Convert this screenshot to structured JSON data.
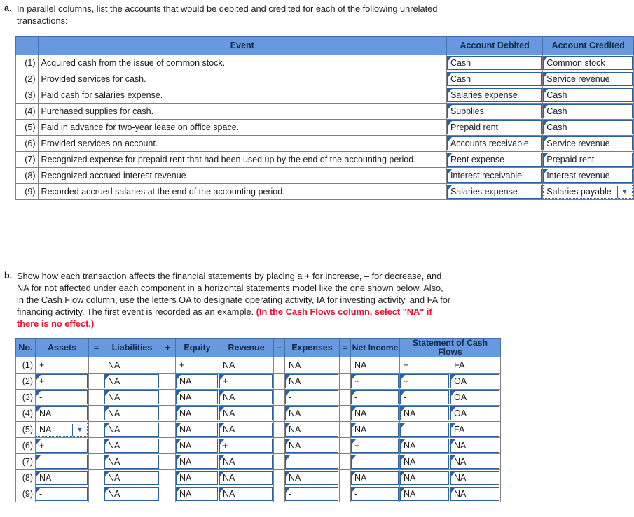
{
  "prompt_a": {
    "letter": "a.",
    "text": "In parallel columns, list the accounts that would be debited and credited for each of the following unrelated transactions:"
  },
  "prompt_b": {
    "letter": "b.",
    "text": "Show how each transaction affects the financial statements by placing a + for increase, – for decrease, and NA for not affected under each component in a horizontal statements model like the one shown below. Also, in the Cash Flow column, use the letters OA to designate operating activity, IA for investing activity, and FA for financing activity. The first event is recorded as an example. ",
    "highlight": "(In the Cash Flows column, select \"NA\" if there is no effect.)"
  },
  "accounts_table": {
    "headers": {
      "num": "",
      "event": "Event",
      "debited": "Account Debited",
      "credited": "Account Credited"
    },
    "rows": [
      {
        "num": "(1)",
        "event": "Acquired cash from the issue of common stock.",
        "debited": "Cash",
        "credited": "Common stock",
        "active": ""
      },
      {
        "num": "(2)",
        "event": "Provided services for cash.",
        "debited": "Cash",
        "credited": "Service revenue",
        "active": ""
      },
      {
        "num": "(3)",
        "event": "Paid cash for salaries expense.",
        "debited": "Salaries expense",
        "credited": "Cash",
        "active": ""
      },
      {
        "num": "(4)",
        "event": "Purchased supplies for cash.",
        "debited": "Supplies",
        "credited": "Cash",
        "active": ""
      },
      {
        "num": "(5)",
        "event": "Paid in advance for two-year lease on office space.",
        "debited": "Prepaid rent",
        "credited": "Cash",
        "active": ""
      },
      {
        "num": "(6)",
        "event": "Provided services on account.",
        "debited": "Accounts receivable",
        "credited": "Service revenue",
        "active": ""
      },
      {
        "num": "(7)",
        "event": "Recognized expense for prepaid rent that had been used up by the end of the accounting period.",
        "debited": "Rent expense",
        "credited": "Prepaid rent",
        "active": ""
      },
      {
        "num": "(8)",
        "event": "Recognized accrued interest revenue",
        "debited": "Interest receivable",
        "credited": "Interest revenue",
        "active": ""
      },
      {
        "num": "(9)",
        "event": "Recorded accrued salaries at the end of the accounting period.",
        "debited": "Salaries expense",
        "credited": "Salaries payable",
        "active": "credited"
      }
    ]
  },
  "model_table": {
    "headers": {
      "no": "No.",
      "assets": "Assets",
      "eq1": "=",
      "liabilities": "Liabilities",
      "plus1": "+",
      "equity": "Equity",
      "revenue": "Revenue",
      "minus": "–",
      "expenses": "Expenses",
      "eq2": "=",
      "net_income": "Net Income",
      "cash_flows": "Statement of Cash Flows"
    },
    "rows": [
      {
        "no": "(1)",
        "assets": "+",
        "liabilities": "NA",
        "equity": "+",
        "revenue": "NA",
        "expenses": "NA",
        "net_income": "NA",
        "cf_sign": "+",
        "cf_type": "FA",
        "example": true,
        "active": ""
      },
      {
        "no": "(2)",
        "assets": "+",
        "liabilities": "NA",
        "equity": "NA",
        "revenue": "+",
        "expenses": "NA",
        "net_income": "+",
        "cf_sign": "+",
        "cf_type": "OA",
        "example": false,
        "active": ""
      },
      {
        "no": "(3)",
        "assets": "-",
        "liabilities": "NA",
        "equity": "NA",
        "revenue": "NA",
        "expenses": "-",
        "net_income": "-",
        "cf_sign": "-",
        "cf_type": "OA",
        "example": false,
        "active": ""
      },
      {
        "no": "(4)",
        "assets": "NA",
        "liabilities": "NA",
        "equity": "NA",
        "revenue": "NA",
        "expenses": "NA",
        "net_income": "NA",
        "cf_sign": "NA",
        "cf_type": "OA",
        "example": false,
        "active": ""
      },
      {
        "no": "(5)",
        "assets": "NA",
        "liabilities": "NA",
        "equity": "NA",
        "revenue": "NA",
        "expenses": "NA",
        "net_income": "NA",
        "cf_sign": "-",
        "cf_type": "FA",
        "example": false,
        "active": "assets"
      },
      {
        "no": "(6)",
        "assets": "+",
        "liabilities": "NA",
        "equity": "NA",
        "revenue": "+",
        "expenses": "NA",
        "net_income": "+",
        "cf_sign": "NA",
        "cf_type": "NA",
        "example": false,
        "active": ""
      },
      {
        "no": "(7)",
        "assets": "-",
        "liabilities": "NA",
        "equity": "NA",
        "revenue": "NA",
        "expenses": "-",
        "net_income": "-",
        "cf_sign": "NA",
        "cf_type": "NA",
        "example": false,
        "active": ""
      },
      {
        "no": "(8)",
        "assets": "NA",
        "liabilities": "NA",
        "equity": "NA",
        "revenue": "NA",
        "expenses": "NA",
        "net_income": "NA",
        "cf_sign": "NA",
        "cf_type": "NA",
        "example": false,
        "active": ""
      },
      {
        "no": "(9)",
        "assets": "-",
        "liabilities": "NA",
        "equity": "NA",
        "revenue": "NA",
        "expenses": "-",
        "net_income": "-",
        "cf_sign": "NA",
        "cf_type": "NA",
        "example": false,
        "active": ""
      }
    ]
  },
  "icons": {
    "dropdown_arrow": "▼"
  },
  "colors": {
    "header_blue": "#6699e0",
    "cell_border_blue": "#2e5f9e",
    "grid_gray": "#808080",
    "highlight_red": "#e8112d"
  }
}
